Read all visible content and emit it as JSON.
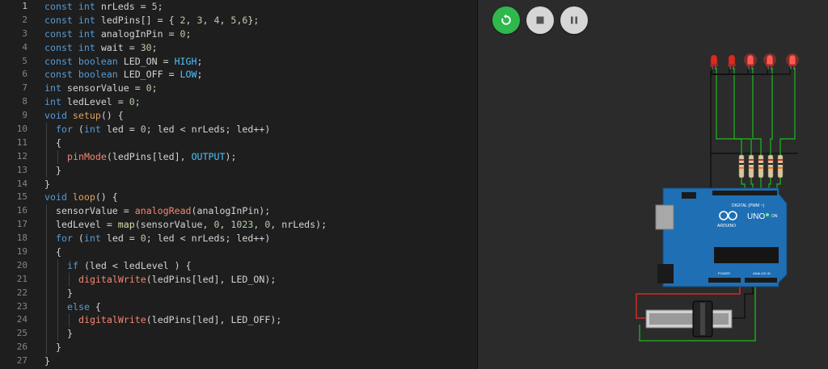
{
  "editor": {
    "active_line": 1,
    "lines": [
      {
        "n": "1",
        "indent": 0,
        "tokens": [
          [
            "kw",
            "const"
          ],
          [
            "t",
            " "
          ],
          [
            "kw",
            "int"
          ],
          [
            "t",
            " nrLeds = "
          ],
          [
            "num",
            "5"
          ],
          [
            "t",
            ";"
          ]
        ]
      },
      {
        "n": "2",
        "indent": 0,
        "tokens": [
          [
            "kw",
            "const"
          ],
          [
            "t",
            " "
          ],
          [
            "kw",
            "int"
          ],
          [
            "t",
            " ledPins[] = { "
          ],
          [
            "num",
            "2"
          ],
          [
            "t",
            ", "
          ],
          [
            "num",
            "3"
          ],
          [
            "t",
            ", "
          ],
          [
            "num",
            "4"
          ],
          [
            "t",
            ", "
          ],
          [
            "num",
            "5"
          ],
          [
            "t",
            ","
          ],
          [
            "num",
            "6"
          ],
          [
            "t",
            "};"
          ]
        ]
      },
      {
        "n": "3",
        "indent": 0,
        "tokens": [
          [
            "kw",
            "const"
          ],
          [
            "t",
            " "
          ],
          [
            "kw",
            "int"
          ],
          [
            "t",
            " analogInPin = "
          ],
          [
            "num",
            "0"
          ],
          [
            "t",
            ";"
          ]
        ]
      },
      {
        "n": "4",
        "indent": 0,
        "tokens": [
          [
            "kw",
            "const"
          ],
          [
            "t",
            " "
          ],
          [
            "kw",
            "int"
          ],
          [
            "t",
            " wait = "
          ],
          [
            "num",
            "30"
          ],
          [
            "t",
            ";"
          ]
        ]
      },
      {
        "n": "5",
        "indent": 0,
        "tokens": [
          [
            "kw",
            "const"
          ],
          [
            "t",
            " "
          ],
          [
            "kw",
            "boolean"
          ],
          [
            "t",
            " LED_ON = "
          ],
          [
            "cst",
            "HIGH"
          ],
          [
            "t",
            ";"
          ]
        ]
      },
      {
        "n": "6",
        "indent": 0,
        "tokens": [
          [
            "kw",
            "const"
          ],
          [
            "t",
            " "
          ],
          [
            "kw",
            "boolean"
          ],
          [
            "t",
            " LED_OFF = "
          ],
          [
            "cst",
            "LOW"
          ],
          [
            "t",
            ";"
          ]
        ]
      },
      {
        "n": "7",
        "indent": 0,
        "tokens": [
          [
            "kw",
            "int"
          ],
          [
            "t",
            " sensorValue = "
          ],
          [
            "num",
            "0"
          ],
          [
            "t",
            ";"
          ]
        ]
      },
      {
        "n": "8",
        "indent": 0,
        "tokens": [
          [
            "kw",
            "int"
          ],
          [
            "t",
            " ledLevel = "
          ],
          [
            "num",
            "0"
          ],
          [
            "t",
            ";"
          ]
        ]
      },
      {
        "n": "9",
        "indent": 0,
        "tokens": [
          [
            "kw",
            "void"
          ],
          [
            "t",
            " "
          ],
          [
            "fnr",
            "setup"
          ],
          [
            "t",
            "() {"
          ]
        ]
      },
      {
        "n": "10",
        "indent": 1,
        "tokens": [
          [
            "kw",
            "for"
          ],
          [
            "t",
            " ("
          ],
          [
            "kw",
            "int"
          ],
          [
            "t",
            " led = "
          ],
          [
            "num",
            "0"
          ],
          [
            "t",
            "; led < nrLeds; led++)"
          ]
        ]
      },
      {
        "n": "11",
        "indent": 1,
        "tokens": [
          [
            "t",
            "{"
          ]
        ]
      },
      {
        "n": "12",
        "indent": 2,
        "tokens": [
          [
            "hl",
            "pinMode"
          ],
          [
            "t",
            "(ledPins[led], "
          ],
          [
            "cst",
            "OUTPUT"
          ],
          [
            "t",
            ");"
          ]
        ]
      },
      {
        "n": "13",
        "indent": 1,
        "tokens": [
          [
            "t",
            "}"
          ]
        ]
      },
      {
        "n": "14",
        "indent": 0,
        "tokens": [
          [
            "t",
            "}"
          ]
        ]
      },
      {
        "n": "15",
        "indent": 0,
        "tokens": [
          [
            "kw",
            "void"
          ],
          [
            "t",
            " "
          ],
          [
            "fnr",
            "loop"
          ],
          [
            "t",
            "() {"
          ]
        ]
      },
      {
        "n": "16",
        "indent": 1,
        "tokens": [
          [
            "t",
            "sensorValue = "
          ],
          [
            "hl",
            "analogRead"
          ],
          [
            "t",
            "(analogInPin);"
          ]
        ]
      },
      {
        "n": "17",
        "indent": 1,
        "tokens": [
          [
            "t",
            "ledLevel = "
          ],
          [
            "fn",
            "map"
          ],
          [
            "t",
            "(sensorValue, "
          ],
          [
            "num",
            "0"
          ],
          [
            "t",
            ", "
          ],
          [
            "num",
            "1023"
          ],
          [
            "t",
            ", "
          ],
          [
            "num",
            "0"
          ],
          [
            "t",
            ", nrLeds);"
          ]
        ]
      },
      {
        "n": "18",
        "indent": 1,
        "tokens": [
          [
            "kw",
            "for"
          ],
          [
            "t",
            " ("
          ],
          [
            "kw",
            "int"
          ],
          [
            "t",
            " led = "
          ],
          [
            "num",
            "0"
          ],
          [
            "t",
            "; led < nrLeds; led++)"
          ]
        ]
      },
      {
        "n": "19",
        "indent": 1,
        "tokens": [
          [
            "t",
            "{"
          ]
        ]
      },
      {
        "n": "20",
        "indent": 2,
        "tokens": [
          [
            "kw",
            "if"
          ],
          [
            "t",
            " (led < ledLevel ) {"
          ]
        ]
      },
      {
        "n": "21",
        "indent": 3,
        "tokens": [
          [
            "hl",
            "digitalWrite"
          ],
          [
            "t",
            "(ledPins[led], LED_ON);"
          ]
        ]
      },
      {
        "n": "22",
        "indent": 2,
        "tokens": [
          [
            "t",
            "}"
          ]
        ]
      },
      {
        "n": "23",
        "indent": 2,
        "tokens": [
          [
            "kw",
            "else"
          ],
          [
            "t",
            " {"
          ]
        ]
      },
      {
        "n": "24",
        "indent": 3,
        "tokens": [
          [
            "hl",
            "digitalWrite"
          ],
          [
            "t",
            "(ledPins[led], LED_OFF);"
          ]
        ]
      },
      {
        "n": "25",
        "indent": 2,
        "tokens": [
          [
            "t",
            "}"
          ]
        ]
      },
      {
        "n": "26",
        "indent": 1,
        "tokens": [
          [
            "t",
            "}"
          ]
        ]
      },
      {
        "n": "27",
        "indent": 0,
        "tokens": [
          [
            "t",
            "}"
          ]
        ]
      }
    ]
  },
  "toolbar": {
    "restart_icon": "restart-icon",
    "stop_icon": "stop-icon",
    "pause_icon": "pause-icon"
  },
  "board": {
    "brand": "ARDUINO",
    "model": "UNO",
    "digital_label": "DIGITAL (PWM ~)",
    "analog_label": "ANALOG IN",
    "power_label": "POWER",
    "on_label": "ON"
  },
  "leds": {
    "count": 5,
    "lit": [
      false,
      false,
      true,
      true,
      true
    ]
  },
  "colors": {
    "restart": "#2fb84c",
    "board": "#1f6fb4",
    "led_red": "#ff3b30",
    "wire_green": "#1ea51e",
    "wire_black": "#111111",
    "wire_red": "#d22b2b"
  }
}
